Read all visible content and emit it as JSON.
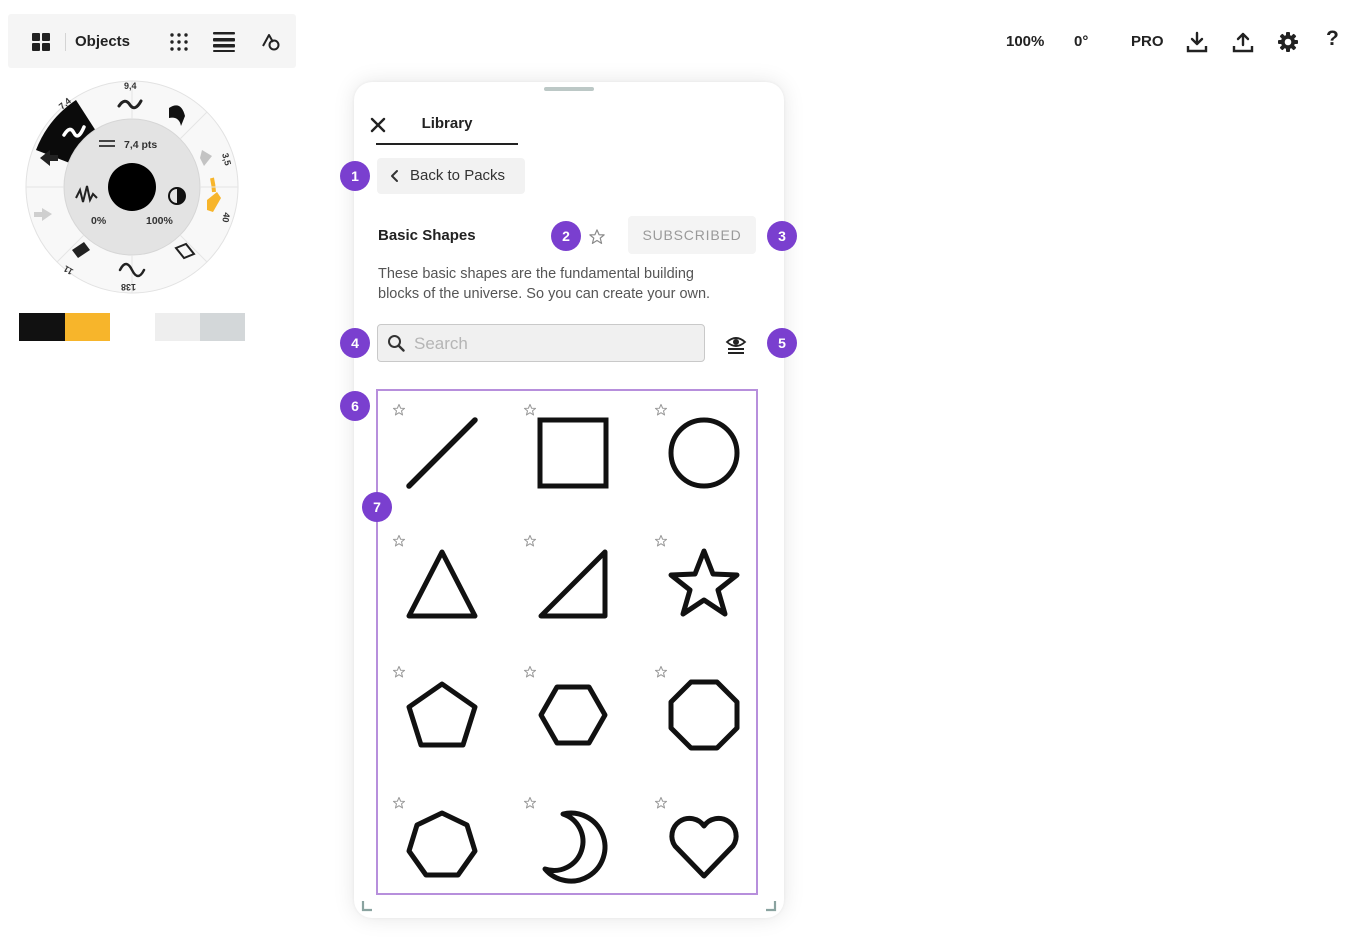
{
  "toolbar_left": {
    "objects_label": "Objects",
    "icons": [
      "objects-icon",
      "grid-icon",
      "layers-icon",
      "shapes-icon"
    ]
  },
  "brush_wheel": {
    "size_top_left": "7,4",
    "size_top": "9,4",
    "size_right_top": "3,5",
    "size_right": "40",
    "size_bottom": "138",
    "size_bottom_left": "11",
    "stroke_size": "7,4 pts",
    "opacity_min": "0%",
    "opacity_max": "100%",
    "active_color": "#000000",
    "selected_tool_color": "#ffb81c"
  },
  "swatches": [
    "#111111",
    "#f7b52b",
    "#eeeeee",
    "#d3d7d9"
  ],
  "toolbar_right": {
    "zoom": "100%",
    "rotation": "0°",
    "pro": "PRO",
    "icons": [
      "download-icon",
      "upload-icon",
      "settings-icon",
      "help-icon"
    ],
    "help_label": "?"
  },
  "library": {
    "tab_label": "Library",
    "back_label": "Back to Packs",
    "pack_title": "Basic Shapes",
    "subscribe_label": "SUBSCRIBED",
    "description_line1": "These basic shapes are the fundamental building",
    "description_line2": "blocks of the universe. So you can create your own.",
    "search_placeholder": "Search",
    "search_value": "",
    "shapes": [
      "line",
      "square",
      "circle",
      "triangle",
      "right-triangle",
      "star",
      "pentagon",
      "hexagon",
      "octagon",
      "heptagon",
      "crescent",
      "heart"
    ]
  },
  "badges": [
    "1",
    "2",
    "3",
    "4",
    "5",
    "6",
    "7"
  ],
  "colors": {
    "badge": "#7a3fcf",
    "grid_outline": "#b78fdc",
    "accent_yellow": "#f7b52b"
  }
}
